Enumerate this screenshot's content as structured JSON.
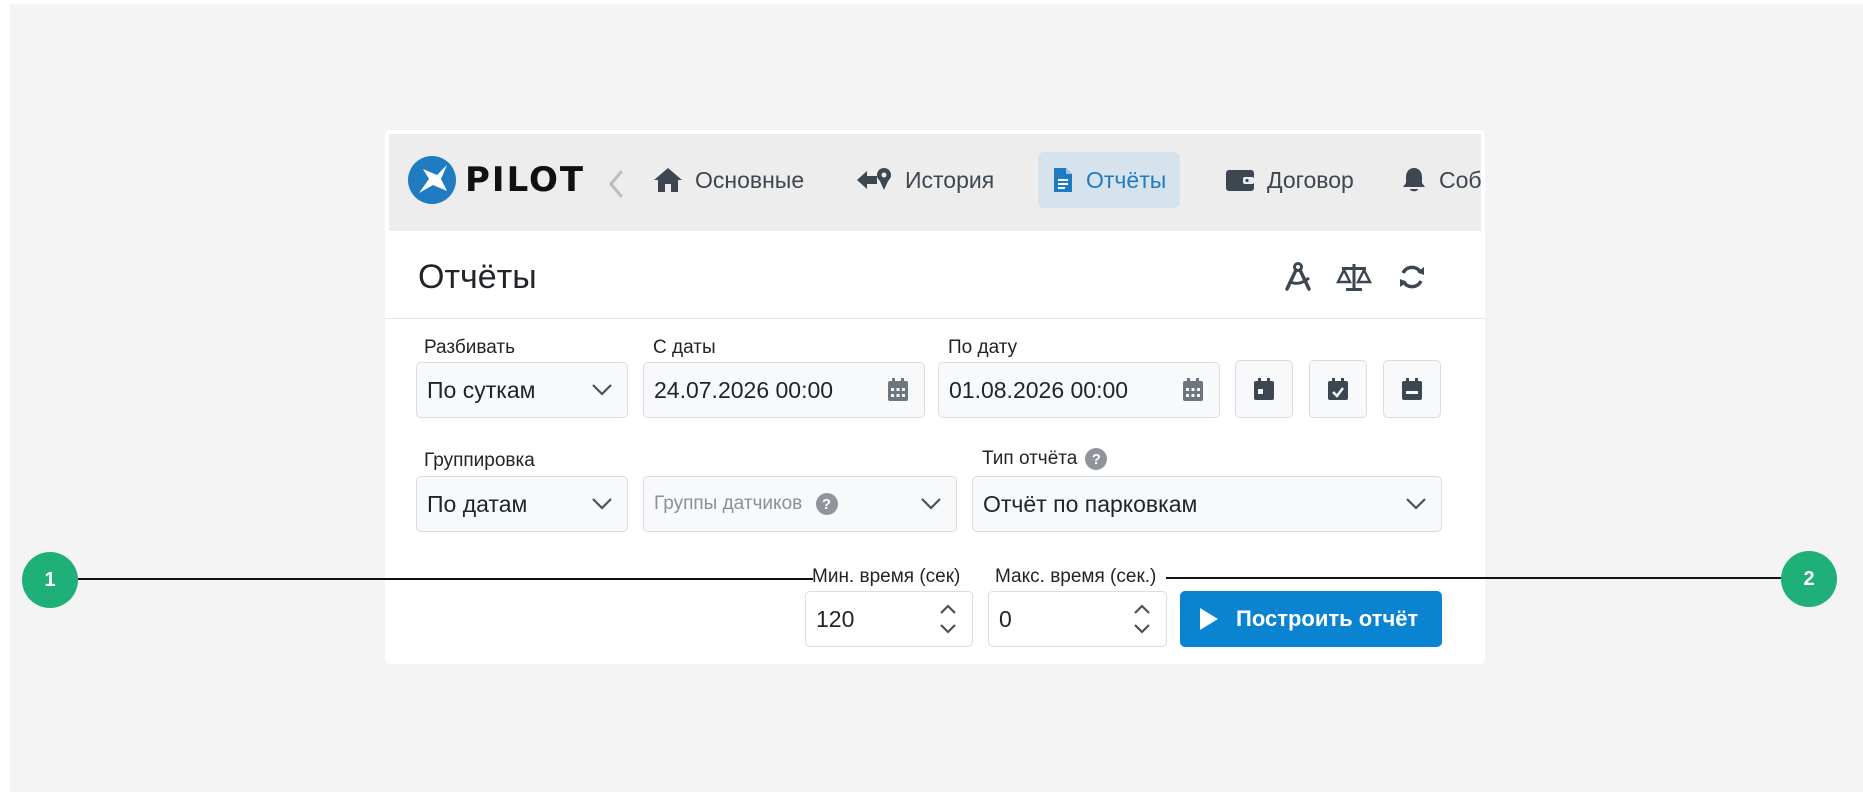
{
  "brand": {
    "name": "PILOT",
    "accent": "#1f7cc1"
  },
  "nav": {
    "items": [
      {
        "label": "Основные",
        "icon": "home-icon"
      },
      {
        "label": "История",
        "icon": "history-route-icon"
      },
      {
        "label": "Отчёты",
        "icon": "document-icon",
        "active": true
      },
      {
        "label": "Договор",
        "icon": "wallet-icon"
      },
      {
        "label": "Соб",
        "icon": "bell-icon"
      }
    ]
  },
  "page": {
    "title": "Отчёты",
    "actions": [
      "compass-icon",
      "scales-icon",
      "refresh-icon"
    ]
  },
  "form": {
    "split_label": "Разбивать",
    "split_value": "По суткам",
    "from_label": "С даты",
    "from_value": "24.07.2026 00:00",
    "to_label": "По дату",
    "to_value": "01.08.2026 00:00",
    "grouping_label": "Группировка",
    "grouping_value": "По датам",
    "sensor_groups_placeholder": "Группы датчиков",
    "report_type_label": "Тип отчёта",
    "report_type_value": "Отчёт по парковкам",
    "min_time_label": "Мин. время (сек)",
    "min_time_value": "120",
    "max_time_label": "Макс. время (сек.)",
    "max_time_value": "0",
    "build_label": "Построить отчёт",
    "help_glyph": "?"
  },
  "callouts": {
    "one": "1",
    "two": "2"
  },
  "colors": {
    "callout": "#1fb07a",
    "primary_button": "#0a83d0",
    "active_tab_bg": "#d7e3ec"
  }
}
